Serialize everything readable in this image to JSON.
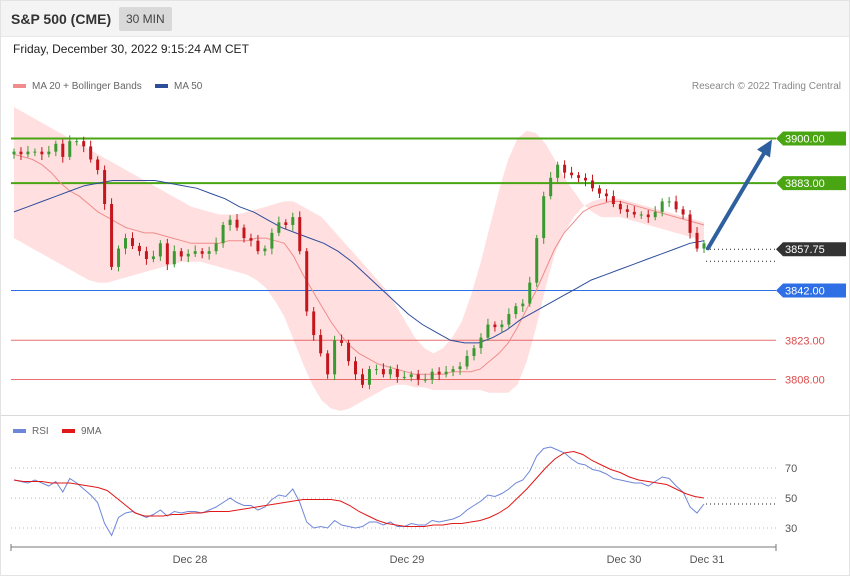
{
  "header": {
    "title": "S&P 500 (CME)",
    "interval": "30 MIN"
  },
  "datetime": "Friday, December 30, 2022 9:15:24 AM CET",
  "legend": {
    "ma20_label": "MA 20 + Bollinger Bands",
    "ma50_label": "MA 50",
    "rsi_label": "RSI",
    "ma9_label": "9MA"
  },
  "copyright": "Research © 2022 Trading Central",
  "colors": {
    "up": "#3a9a32",
    "down": "#c4161c",
    "band": "#ffd9d9",
    "ma20": "#f08c8c",
    "ma50": "#2e4d9b",
    "resistance": "#4aa512",
    "support": "#2f6fe6",
    "support_minor": "#e14c4c",
    "arrow": "#2e5f9e",
    "rsi": "#6e86d8",
    "rsi_ma": "#e01818"
  },
  "chart_data": [
    {
      "type": "candlestick",
      "price_range": [
        3796,
        3917
      ],
      "x_ticks": [
        "Dec 28",
        "Dec 29",
        "Dec 30",
        "Dec 31"
      ],
      "current_price": {
        "label": "3857.75",
        "value": 3857.75
      },
      "levels": [
        {
          "label": "3900.00",
          "value": 3900.0,
          "kind": "resistance"
        },
        {
          "label": "3883.00",
          "value": 3883.0,
          "kind": "resistance"
        },
        {
          "label": "3842.00",
          "value": 3842.0,
          "kind": "support"
        },
        {
          "label": "3823.00",
          "value": 3823.0,
          "kind": "support_minor"
        },
        {
          "label": "3808.00",
          "value": 3808.0,
          "kind": "support_minor"
        }
      ],
      "forecast_arrow": {
        "from": 3857.75,
        "to": 3900.0
      },
      "close": [
        3895,
        3894,
        3895,
        3895,
        3894,
        3895,
        3898,
        3893,
        3899,
        3899,
        3897,
        3892,
        3888,
        3875,
        3851,
        3858,
        3862,
        3859,
        3857,
        3854,
        3855,
        3860,
        3852,
        3857,
        3855,
        3856,
        3857,
        3856,
        3857,
        3860,
        3867,
        3869,
        3866,
        3862,
        3861,
        3857,
        3858,
        3864,
        3868,
        3867,
        3870,
        3857,
        3834,
        3825,
        3818,
        3810,
        3823,
        3822,
        3815,
        3810,
        3806,
        3812,
        3812,
        3810,
        3812,
        3809,
        3809,
        3810,
        3808,
        3808,
        3811,
        3810,
        3811,
        3812,
        3813,
        3817,
        3820,
        3824,
        3829,
        3828,
        3829,
        3833,
        3836,
        3837,
        3845,
        3862,
        3878,
        3885,
        3890,
        3887,
        3886,
        3885,
        3884,
        3881,
        3879,
        3878,
        3875,
        3873,
        3872,
        3871,
        3871,
        3870,
        3872,
        3876,
        3876,
        3873,
        3871,
        3864,
        3858,
        3860
      ],
      "ma20": [
        3894,
        3893,
        3892,
        3890,
        3887,
        3883,
        3880,
        3878,
        3875,
        3872,
        3870,
        3868,
        3866,
        3865,
        3864,
        3864,
        3863,
        3862,
        3861,
        3860,
        3860,
        3860,
        3860,
        3861,
        3861,
        3861,
        3862,
        3862,
        3861,
        3860,
        3855,
        3848,
        3842,
        3836,
        3830,
        3825,
        3821,
        3818,
        3816,
        3814,
        3813,
        3812,
        3811,
        3810,
        3810,
        3810,
        3810,
        3811,
        3811,
        3811,
        3812,
        3815,
        3818,
        3822,
        3828,
        3835,
        3842,
        3850,
        3858,
        3864,
        3868,
        3872,
        3874,
        3875,
        3876,
        3876,
        3875,
        3874,
        3873,
        3872,
        3871,
        3870,
        3869,
        3868,
        3867
      ],
      "bb_upper": [
        3912,
        3910,
        3908,
        3906,
        3904,
        3902,
        3900,
        3898,
        3896,
        3894,
        3892,
        3890,
        3888,
        3886,
        3884,
        3882,
        3880,
        3878,
        3876,
        3874,
        3873,
        3872,
        3871,
        3871,
        3871,
        3872,
        3873,
        3874,
        3875,
        3876,
        3876,
        3874,
        3872,
        3870,
        3866,
        3862,
        3858,
        3854,
        3850,
        3846,
        3842,
        3836,
        3830,
        3824,
        3820,
        3818,
        3820,
        3824,
        3830,
        3840,
        3852,
        3866,
        3880,
        3892,
        3900,
        3903,
        3902,
        3898,
        3892,
        3885,
        3880,
        3875,
        3872,
        3870,
        3870,
        3870,
        3869,
        3868,
        3867,
        3866,
        3865,
        3864,
        3863,
        3862,
        3861
      ],
      "bb_lower": [
        3862,
        3860,
        3858,
        3856,
        3854,
        3852,
        3850,
        3848,
        3846,
        3845,
        3845,
        3846,
        3847,
        3848,
        3849,
        3850,
        3851,
        3852,
        3853,
        3853,
        3853,
        3852,
        3851,
        3850,
        3849,
        3848,
        3846,
        3843,
        3838,
        3832,
        3823,
        3814,
        3806,
        3800,
        3797,
        3796,
        3797,
        3799,
        3801,
        3803,
        3805,
        3806,
        3806,
        3805,
        3805,
        3804,
        3804,
        3804,
        3804,
        3804,
        3804,
        3803,
        3803,
        3803,
        3806,
        3815,
        3828,
        3843,
        3856,
        3864,
        3870,
        3874,
        3876,
        3877,
        3877,
        3877,
        3876,
        3875,
        3874,
        3873,
        3872,
        3871,
        3870,
        3869,
        3868
      ],
      "ma50": [
        3872,
        3874,
        3876,
        3878,
        3880,
        3882,
        3883,
        3884,
        3884,
        3884,
        3884,
        3883,
        3882,
        3881,
        3879,
        3877,
        3874,
        3872,
        3869,
        3866,
        3864,
        3862,
        3860,
        3857,
        3853,
        3848,
        3843,
        3838,
        3833,
        3829,
        3826,
        3823,
        3822,
        3822,
        3824,
        3827,
        3831,
        3834,
        3837,
        3840,
        3843,
        3846,
        3848,
        3850,
        3852,
        3854,
        3856,
        3858,
        3860,
        3861
      ]
    },
    {
      "type": "line",
      "series": [
        {
          "name": "RSI",
          "values": [
            62,
            61,
            60,
            62,
            60,
            58,
            61,
            54,
            63,
            60,
            56,
            52,
            47,
            33,
            25,
            37,
            40,
            41,
            39,
            37,
            39,
            42,
            38,
            41,
            40,
            41,
            41,
            40,
            42,
            44,
            47,
            50,
            47,
            45,
            45,
            42,
            44,
            49,
            52,
            51,
            56,
            47,
            34,
            30,
            31,
            30,
            35,
            32,
            31,
            30,
            31,
            34,
            34,
            32,
            34,
            31,
            31,
            33,
            32,
            32,
            35,
            34,
            35,
            36,
            38,
            42,
            45,
            48,
            52,
            51,
            53,
            56,
            60,
            62,
            68,
            78,
            83,
            84,
            82,
            80,
            76,
            73,
            72,
            69,
            68,
            66,
            63,
            62,
            61,
            60,
            60,
            58,
            61,
            64,
            63,
            58,
            54,
            44,
            40,
            46
          ]
        },
        {
          "name": "9MA",
          "values": [
            62,
            61,
            61,
            61,
            60,
            60,
            60,
            59,
            58,
            57,
            55,
            50,
            45,
            40,
            38,
            38,
            38,
            39,
            39,
            40,
            40,
            41,
            41,
            41,
            42,
            43,
            44,
            45,
            46,
            47,
            48,
            49,
            49,
            49,
            49,
            48,
            45,
            41,
            38,
            35,
            33,
            32,
            31,
            31,
            31,
            32,
            32,
            33,
            33,
            34,
            35,
            37,
            40,
            44,
            50,
            56,
            63,
            70,
            76,
            80,
            81,
            79,
            75,
            72,
            69,
            67,
            64,
            62,
            61,
            60,
            59,
            56,
            53,
            51,
            50
          ]
        }
      ],
      "y_ticks": [
        30,
        50,
        70
      ],
      "x_ticks": [
        "Dec 28",
        "Dec 29",
        "Dec 30",
        "Dec 31"
      ]
    }
  ]
}
